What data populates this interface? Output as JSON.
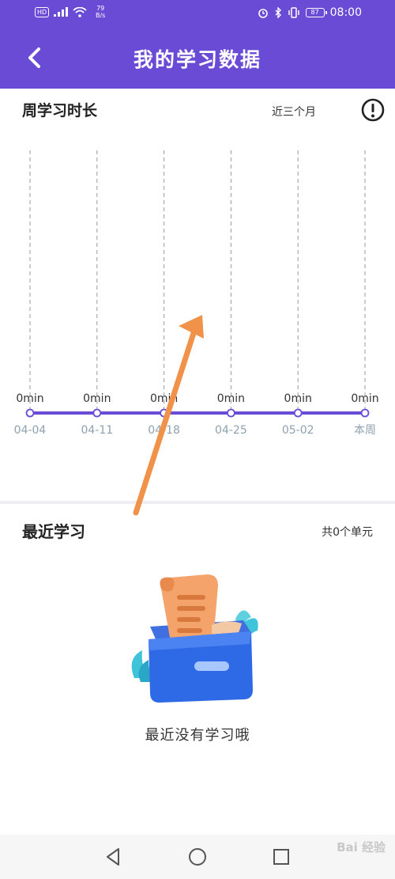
{
  "status_bar": {
    "hd_badge": "HD",
    "network_speed": "79\nB/s",
    "battery": "87",
    "time": "08:00"
  },
  "header": {
    "title": "我的学习数据"
  },
  "weekly_chart": {
    "section_title": "周学习时长",
    "range_label": "近三个月"
  },
  "chart_data": {
    "type": "line",
    "title": "周学习时长",
    "categories": [
      "04-04",
      "04-11",
      "04-18",
      "04-25",
      "05-02",
      "本周"
    ],
    "series": [
      {
        "values": [
          0,
          0,
          0,
          0,
          0,
          0
        ]
      }
    ],
    "data_labels": [
      "0min",
      "0min",
      "0min",
      "0min",
      "0min",
      "0min"
    ],
    "grid": "vertical-dashed",
    "accent_color": "#6a4bd6"
  },
  "recent": {
    "title": "最近学习",
    "count_label": "共0个单元",
    "empty_message": "最近没有学习哦"
  },
  "watermark": "Bai 经验",
  "colors": {
    "brand": "#6a4bd6",
    "annotation_arrow": "#f0924a"
  }
}
